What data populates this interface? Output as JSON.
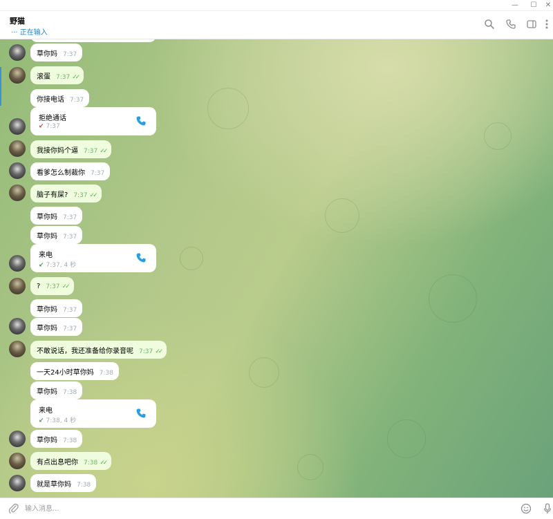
{
  "window": {
    "minimize": "—",
    "maximize": "☐",
    "close": "✕"
  },
  "header": {
    "name": "野猫",
    "status_dots": "···",
    "status": "正在输入",
    "icons": [
      "search-icon",
      "phone-icon",
      "sidebar-icon",
      "more-icon"
    ]
  },
  "messages": [
    {
      "type": "text",
      "dir": "in",
      "text": "草你妈",
      "time": "7:37",
      "avatar": "b"
    },
    {
      "type": "text",
      "dir": "out",
      "text": "滚蛋",
      "time": "7:37",
      "ticks": "✓✓",
      "avatar": "a"
    },
    {
      "type": "text",
      "dir": "in",
      "text": "你接电话",
      "time": "7:37"
    },
    {
      "type": "call",
      "title": "拒绝通话",
      "arrow": "↙",
      "sub": "7:37",
      "status": "declined",
      "avatar": "b"
    },
    {
      "type": "text",
      "dir": "out",
      "text": "我接你妈个逼",
      "time": "7:37",
      "ticks": "✓✓",
      "avatar": "a"
    },
    {
      "type": "text",
      "dir": "in",
      "text": "看爹怎么制裁你",
      "time": "7:37",
      "avatar": "b"
    },
    {
      "type": "text",
      "dir": "out",
      "text": "脑子有屎?",
      "time": "7:37",
      "ticks": "✓✓",
      "avatar": "a"
    },
    {
      "type": "text",
      "dir": "in",
      "text": "草你妈",
      "time": "7:37"
    },
    {
      "type": "text",
      "dir": "in",
      "text": "草你妈",
      "time": "7:37"
    },
    {
      "type": "call",
      "title": "来电",
      "arrow": "↙",
      "sub": "7:37, 4 秒",
      "status": "incoming",
      "avatar": "b"
    },
    {
      "type": "text",
      "dir": "out",
      "text": "?",
      "time": "7:37",
      "ticks": "✓✓",
      "avatar": "a"
    },
    {
      "type": "text",
      "dir": "in",
      "text": "草你妈",
      "time": "7:37"
    },
    {
      "type": "text",
      "dir": "in",
      "text": "草你妈",
      "time": "7:37",
      "avatar": "b"
    },
    {
      "type": "text",
      "dir": "out",
      "text": "不敢说话，我还准备给你录音呢",
      "time": "7:37",
      "ticks": "✓✓",
      "avatar": "a"
    },
    {
      "type": "text",
      "dir": "in",
      "text": "一天24小时草你妈",
      "time": "7:38"
    },
    {
      "type": "text",
      "dir": "in",
      "text": "草你妈",
      "time": "7:38"
    },
    {
      "type": "call",
      "title": "来电",
      "arrow": "↙",
      "sub": "7:38, 4 秒",
      "status": "incoming"
    },
    {
      "type": "text",
      "dir": "in",
      "text": "草你妈",
      "time": "7:38",
      "avatar": "b"
    },
    {
      "type": "text",
      "dir": "out",
      "text": "有点出息吧你",
      "time": "7:38",
      "ticks": "✓✓",
      "avatar": "a"
    },
    {
      "type": "text",
      "dir": "in",
      "text": "就是草你妈",
      "time": "7:38",
      "avatar": "b"
    }
  ],
  "composer": {
    "placeholder": "输入消息...",
    "icons": [
      "attach-icon",
      "emoji-icon",
      "microphone-icon"
    ]
  },
  "colors": {
    "accent": "#168acd",
    "outgoing_bubble": "#effdde",
    "incoming_bubble": "#ffffff",
    "check": "#59b150",
    "declined": "#e53935",
    "incoming_call": "#43a047",
    "phone": "#2a9ee0"
  }
}
